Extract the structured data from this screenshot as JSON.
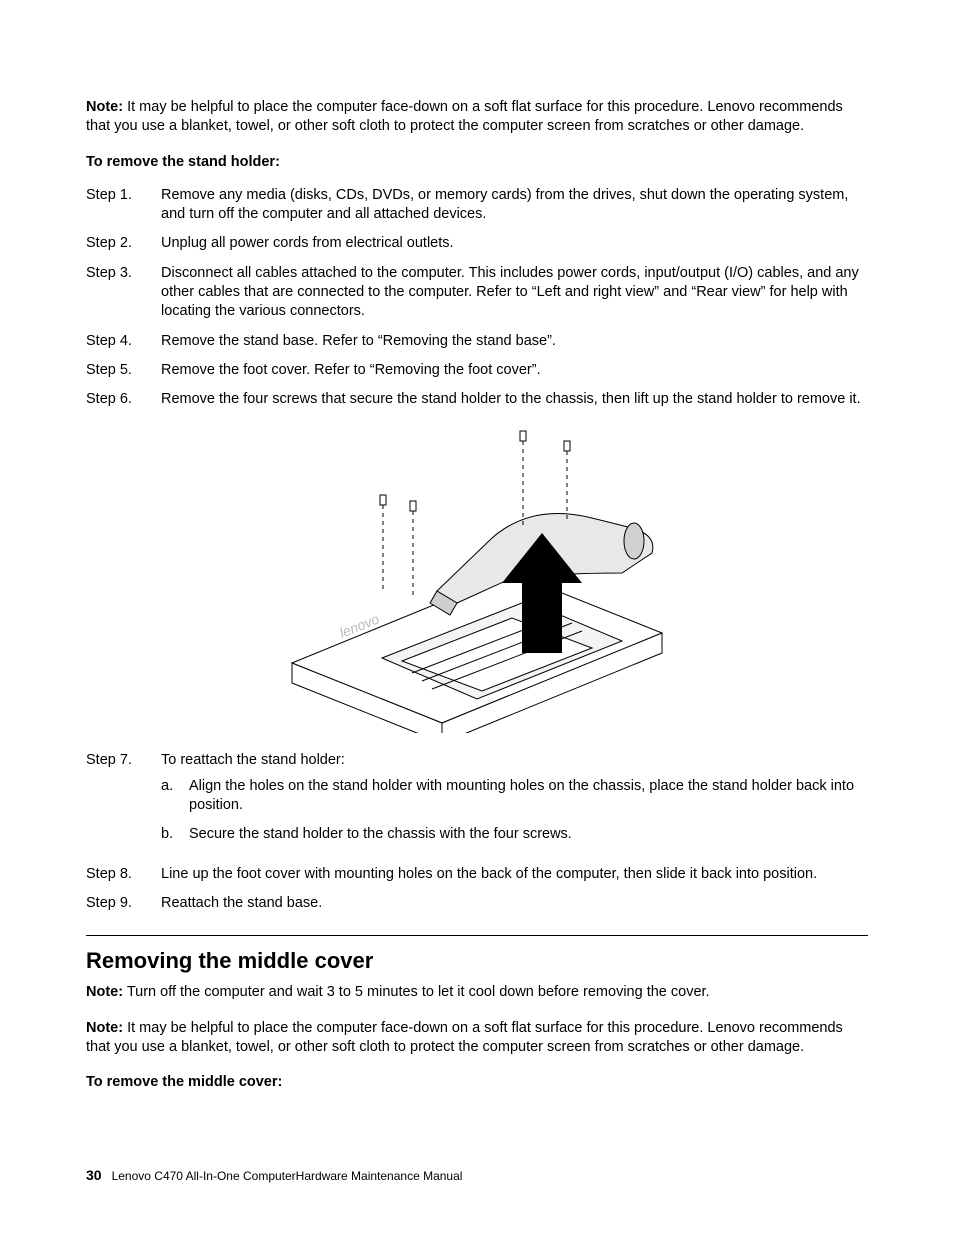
{
  "note1": {
    "label": "Note:",
    "text": " It may be helpful to place the computer face-down on a soft flat surface for this procedure. Lenovo recommends that you use a blanket, towel, or other soft cloth to protect the computer screen from scratches or other damage."
  },
  "subhead1": "To remove the stand holder:",
  "steps_a": [
    {
      "label": "Step 1.",
      "text": "Remove any media (disks, CDs, DVDs, or memory cards) from the drives, shut down the operating system, and turn off the computer and all attached devices."
    },
    {
      "label": "Step 2.",
      "text": "Unplug all power cords from electrical outlets."
    },
    {
      "label": "Step 3.",
      "text": "Disconnect all cables attached to the computer. This includes power cords, input/output (I/O) cables, and any other cables that are connected to the computer. Refer to “Left and right view” and “Rear view” for help with locating the various connectors."
    },
    {
      "label": "Step 4.",
      "text": "Remove the stand base. Refer to “Removing the stand base”."
    },
    {
      "label": "Step 5.",
      "text": "Remove the foot cover. Refer to “Removing the foot cover”."
    },
    {
      "label": "Step 6.",
      "text": "Remove the four screws that secure the stand holder to the chassis, then lift up the stand holder to remove it."
    }
  ],
  "step7": {
    "label": "Step 7.",
    "text": "To reattach the stand holder:"
  },
  "step7_sub": [
    {
      "label": "a.",
      "text": "Align the holes on the stand holder with mounting holes on the chassis, place the stand holder back into position."
    },
    {
      "label": "b.",
      "text": "Secure the stand holder to the chassis with the four screws."
    }
  ],
  "steps_b": [
    {
      "label": "Step 8.",
      "text": "Line up the foot cover with mounting holes on the back of the computer, then slide it back into position."
    },
    {
      "label": "Step 9.",
      "text": "Reattach the stand base."
    }
  ],
  "section_title": "Removing the middle cover",
  "note2": {
    "label": "Note:",
    "text": " Turn off the computer and wait 3 to 5 minutes to let it cool down before removing the cover."
  },
  "note3": {
    "label": "Note:",
    "text": " It may be helpful to place the computer face-down on a soft flat surface for this procedure. Lenovo recommends that you use a blanket, towel, or other soft cloth to protect the computer screen from scratches or other damage."
  },
  "subhead2": "To remove the middle cover:",
  "footer": {
    "page": "30",
    "title": "Lenovo C470 All-In-One ComputerHardware Maintenance Manual"
  }
}
